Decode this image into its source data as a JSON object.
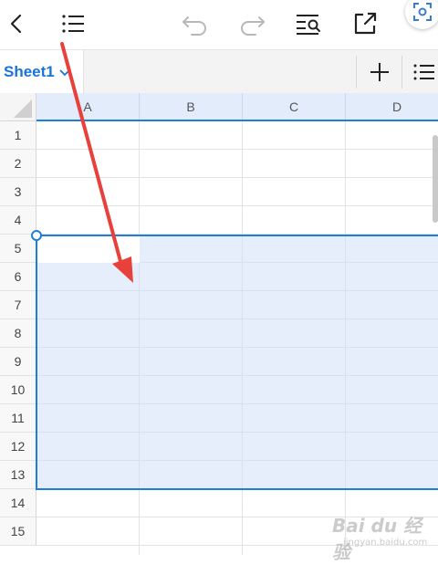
{
  "toolbar": {
    "icons": [
      "back-icon",
      "outline-list-icon",
      "undo-icon",
      "redo-icon",
      "find-icon",
      "share-export-icon",
      "scan-icon"
    ]
  },
  "sheet_tabs": {
    "active_tab": "Sheet1",
    "icons": [
      "chevron-down-icon",
      "add-icon",
      "list-icon"
    ]
  },
  "grid": {
    "columns": [
      "A",
      "B",
      "C",
      "D"
    ],
    "rows": [
      "1",
      "2",
      "3",
      "4",
      "5",
      "6",
      "7",
      "8",
      "9",
      "10",
      "11",
      "12",
      "13",
      "14",
      "15"
    ],
    "selected_range_label": "A5:D13"
  },
  "colors": {
    "accent": "#1f7fd6",
    "selection_fill": "#d2e0fa",
    "annotation_arrow": "#e8403a"
  },
  "watermark": {
    "main": "Bai du 经验",
    "sub": "jingyan.baidu.com"
  }
}
